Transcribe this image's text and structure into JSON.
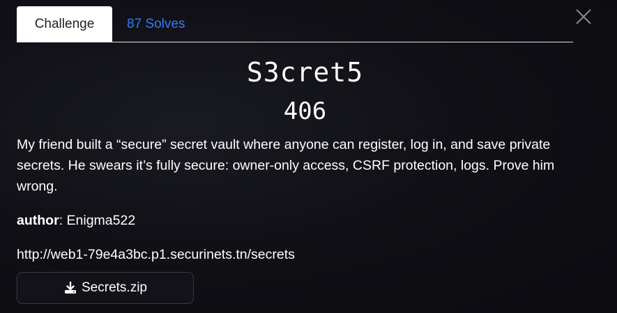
{
  "tabs": {
    "challenge_label": "Challenge",
    "solves_label": "87 Solves"
  },
  "challenge": {
    "name": "S3cret5",
    "points": "406",
    "description": "My friend built a “secure” secret vault where anyone can register, log in, and save private secrets. He swears it’s fully secure: owner-only access, CSRF protection, logs. Prove him wrong.",
    "author_label": "author",
    "author_separator": ":",
    "author_value": " Enigma522",
    "url": "http://web1-79e4a3bc.p1.securinets.tn/secrets",
    "file_label": "Secrets.zip"
  },
  "icons": {
    "close": "close-icon",
    "download": "download-icon"
  },
  "colors": {
    "background": "#0d0d12",
    "tab_link": "#2f7df6",
    "active_tab_bg": "#ffffff",
    "text": "#ffffff"
  }
}
